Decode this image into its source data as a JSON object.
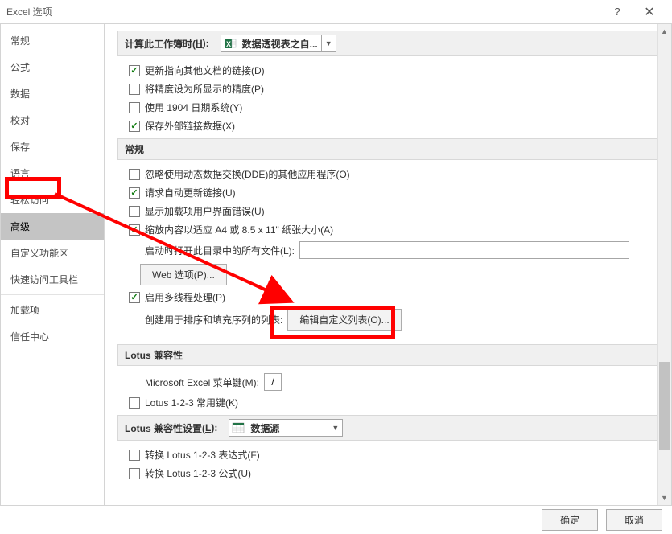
{
  "window": {
    "title": "Excel 选项",
    "help": "?",
    "close": "✕"
  },
  "sidebar": {
    "items": [
      "常规",
      "公式",
      "数据",
      "校对",
      "保存",
      "语言",
      "轻松访问",
      "高级",
      "自定义功能区",
      "快速访问工具栏",
      "加载项",
      "信任中心"
    ],
    "selected_index": 7
  },
  "content": {
    "calc_header_prefix": "计算此工作簿时(",
    "calc_header_key": "H",
    "calc_header_suffix": "):",
    "calc_combo": "数据透视表之自...",
    "general_header": "常规",
    "lotus_compat_header": "Lotus 兼容性",
    "lotus_settings_prefix": "Lotus 兼容性设置(",
    "lotus_settings_key": "L",
    "lotus_settings_suffix": "):",
    "lotus_settings_combo": "数据源",
    "options": {
      "update_links": "更新指向其他文档的链接(D)",
      "precision_displayed": "将精度设为所显示的精度(P)",
      "use_1904": "使用 1904 日期系统(Y)",
      "save_ext_link": "保存外部链接数据(X)",
      "ignore_dde": "忽略使用动态数据交换(DDE)的其他应用程序(O)",
      "req_auto_update": "请求自动更新链接(U)",
      "show_addin_err": "显示加载项用户界面错误(U)",
      "scale_to_paper": "缩放内容以适应 A4 或 8.5 x 11\" 纸张大小(A)",
      "startup_files_label": "启动时打开此目录中的所有文件(L):",
      "web_options": "Web 选项(P)...",
      "enable_multithread": "启用多线程处理(P)",
      "create_list_label": "创建用于排序和填充序列的列表:",
      "edit_custom_list": "编辑自定义列表(O)...",
      "ms_excel_menu_key": "Microsoft Excel 菜单键(M):",
      "menu_key_value": "/",
      "lotus_help": "Lotus 1-2-3 常用键(K)",
      "lotus_formula": "转换 Lotus 1-2-3 表达式(F)",
      "lotus_formula_entry": "转换 Lotus 1-2-3 公式(U)"
    }
  },
  "footer": {
    "ok": "确定",
    "cancel": "取消"
  }
}
